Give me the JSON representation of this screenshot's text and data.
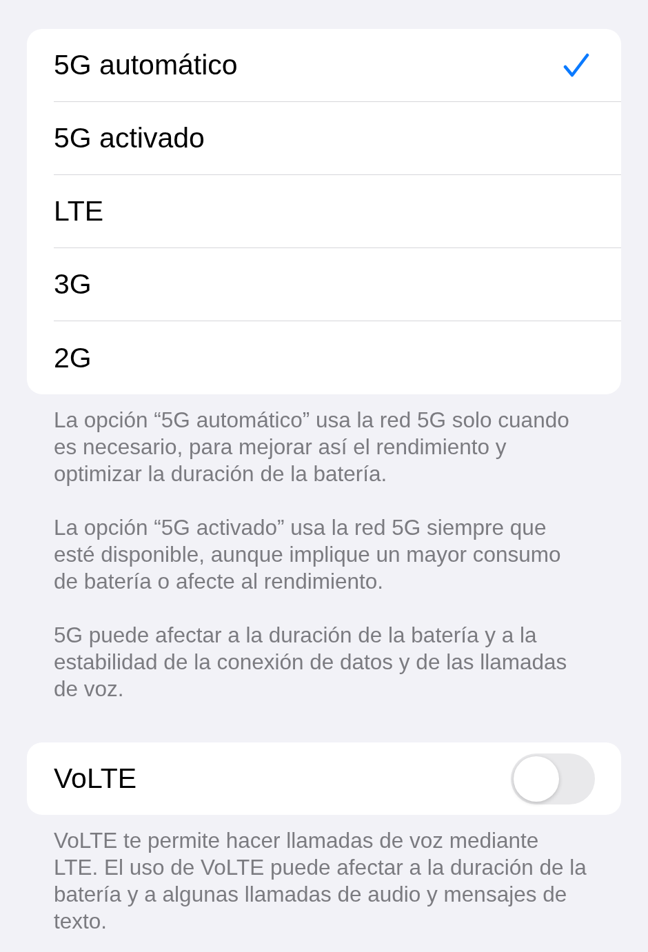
{
  "network_options": [
    {
      "label": "5G automático",
      "selected": true
    },
    {
      "label": "5G activado",
      "selected": false
    },
    {
      "label": "LTE",
      "selected": false
    },
    {
      "label": "3G",
      "selected": false
    },
    {
      "label": "2G",
      "selected": false
    }
  ],
  "network_footer": [
    "La opción “5G automático” usa la red 5G solo cuando es necesario, para mejorar así el rendimiento y optimizar la duración de la batería.",
    "La opción “5G activado” usa la red 5G siempre que esté disponible, aunque implique un mayor consumo de batería o afecte al rendimiento.",
    "5G puede afectar a la duración de la batería y a la estabilidad de la conexión de datos y de las llamadas de voz."
  ],
  "volte": {
    "label": "VoLTE",
    "on": false,
    "footer": [
      "VoLTE te permite hacer llamadas de voz mediante LTE. El uso de VoLTE puede afectar a la duración de la batería y a algunas llamadas de audio y mensajes de texto."
    ]
  }
}
